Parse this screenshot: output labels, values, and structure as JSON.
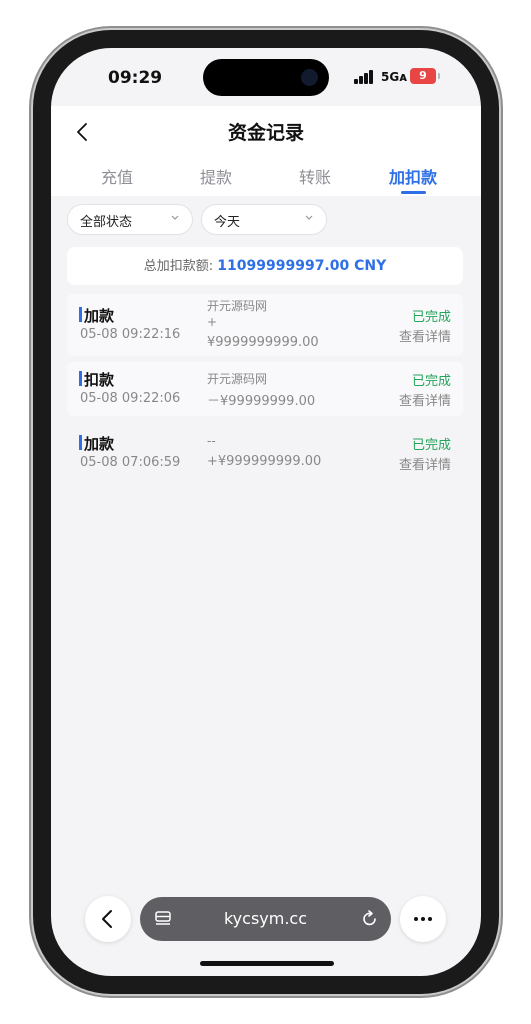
{
  "status_bar": {
    "time": "09:29",
    "network": "5Gᴀ",
    "battery": "9"
  },
  "header": {
    "title": "资金记录",
    "tabs": [
      {
        "label": "充值",
        "active": false
      },
      {
        "label": "提款",
        "active": false
      },
      {
        "label": "转账",
        "active": false
      },
      {
        "label": "加扣款",
        "active": true
      }
    ]
  },
  "filters": {
    "status": "全部状态",
    "date": "今天"
  },
  "summary": {
    "label": "总加扣款额:",
    "amount": "11099999997.00 CNY"
  },
  "records": [
    {
      "type": "加款",
      "datetime": "05-08 09:22:16",
      "source": "开元源码网",
      "sign": "+",
      "amount": "¥9999999999.00",
      "status": "已完成",
      "detail": "查看详情"
    },
    {
      "type": "扣款",
      "datetime": "05-08 09:22:06",
      "source": "开元源码网",
      "amount": "－¥99999999.00",
      "status": "已完成",
      "detail": "查看详情"
    },
    {
      "type": "加款",
      "datetime": "05-08 07:06:59",
      "source": "--",
      "amount": "+¥999999999.00",
      "status": "已完成",
      "detail": "查看详情"
    }
  ],
  "browser": {
    "url": "kycsym.cc"
  },
  "colors": {
    "accent": "#2f6fe6",
    "success": "#23a55a"
  }
}
